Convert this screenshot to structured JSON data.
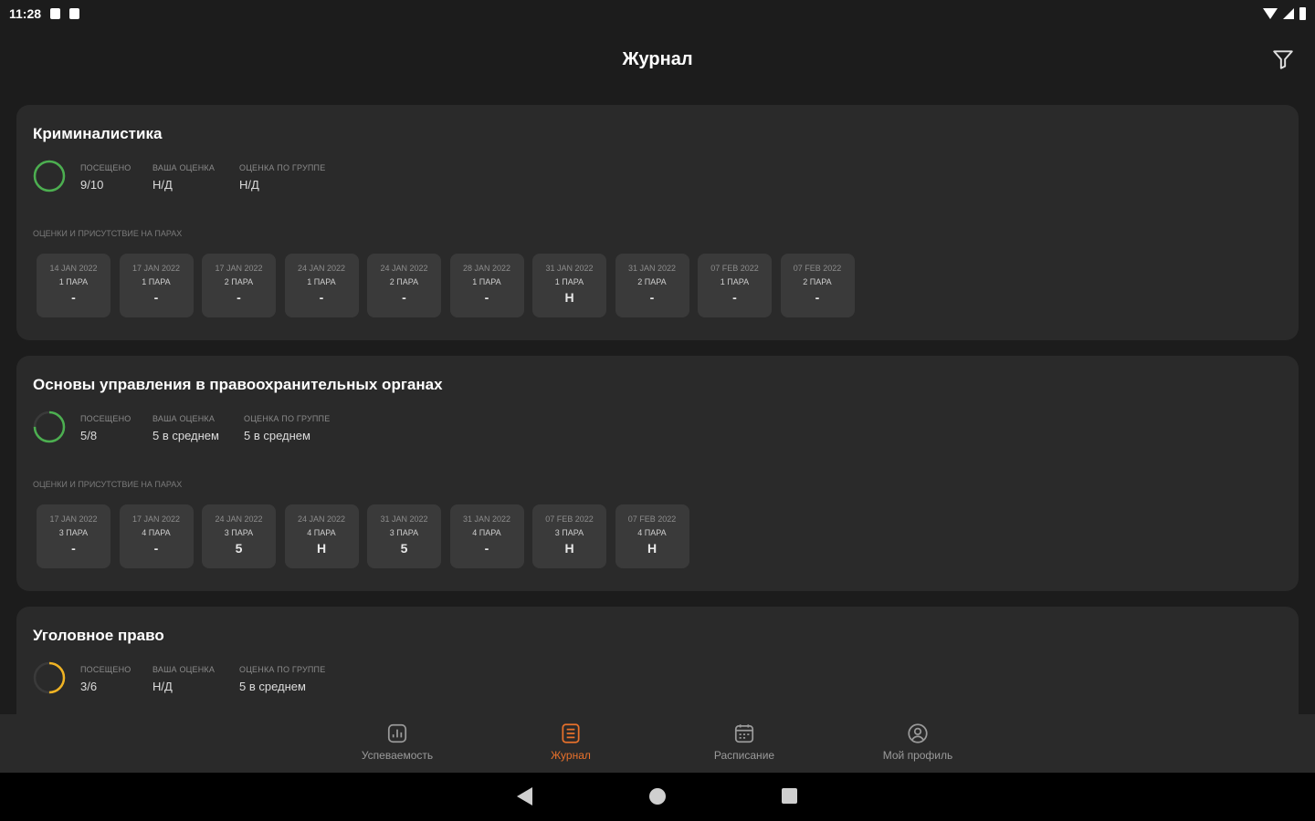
{
  "status_bar": {
    "time": "11:28"
  },
  "app_bar": {
    "title": "Журнал"
  },
  "cards": [
    {
      "title": "Криминалистика",
      "progress": {
        "fraction": 1.0,
        "color": "#4caf50"
      },
      "stats": [
        {
          "label": "посещено",
          "value": "9/10"
        },
        {
          "label": "ваша оценка",
          "value": "Н/Д"
        },
        {
          "label": "оценка по группе",
          "value": "Н/Д"
        }
      ],
      "section_label": "оценки и присутствие на парах",
      "lessons": [
        {
          "date": "14 JAN 2022",
          "pair": "1 ПАРА",
          "mark": "-"
        },
        {
          "date": "17 JAN 2022",
          "pair": "1 ПАРА",
          "mark": "-"
        },
        {
          "date": "17 JAN 2022",
          "pair": "2 ПАРА",
          "mark": "-"
        },
        {
          "date": "24 JAN 2022",
          "pair": "1 ПАРА",
          "mark": "-"
        },
        {
          "date": "24 JAN 2022",
          "pair": "2 ПАРА",
          "mark": "-"
        },
        {
          "date": "28 JAN 2022",
          "pair": "1 ПАРА",
          "mark": "-"
        },
        {
          "date": "31 JAN 2022",
          "pair": "1 ПАРА",
          "mark": "Н"
        },
        {
          "date": "31 JAN 2022",
          "pair": "2 ПАРА",
          "mark": "-"
        },
        {
          "date": "07 FEB 2022",
          "pair": "1 ПАРА",
          "mark": "-"
        },
        {
          "date": "07 FEB 2022",
          "pair": "2 ПАРА",
          "mark": "-"
        }
      ]
    },
    {
      "title": "Основы управления в правоохранительных органах",
      "progress": {
        "fraction": 0.75,
        "color": "#4caf50"
      },
      "stats": [
        {
          "label": "посещено",
          "value": "5/8"
        },
        {
          "label": "ваша оценка",
          "value": "5 в среднем"
        },
        {
          "label": "оценка по группе",
          "value": "5 в среднем"
        }
      ],
      "section_label": "оценки и присутствие на парах",
      "lessons": [
        {
          "date": "17 JAN 2022",
          "pair": "3 ПАРА",
          "mark": "-"
        },
        {
          "date": "17 JAN 2022",
          "pair": "4 ПАРА",
          "mark": "-"
        },
        {
          "date": "24 JAN 2022",
          "pair": "3 ПАРА",
          "mark": "5"
        },
        {
          "date": "24 JAN 2022",
          "pair": "4 ПАРА",
          "mark": "Н"
        },
        {
          "date": "31 JAN 2022",
          "pair": "3 ПАРА",
          "mark": "5"
        },
        {
          "date": "31 JAN 2022",
          "pair": "4 ПАРА",
          "mark": "-"
        },
        {
          "date": "07 FEB 2022",
          "pair": "3 ПАРА",
          "mark": "Н"
        },
        {
          "date": "07 FEB 2022",
          "pair": "4 ПАРА",
          "mark": "Н"
        }
      ]
    },
    {
      "title": "Уголовное право",
      "progress": {
        "fraction": 0.5,
        "color": "#f0b323"
      },
      "stats": [
        {
          "label": "посещено",
          "value": "3/6"
        },
        {
          "label": "ваша оценка",
          "value": "Н/Д"
        },
        {
          "label": "оценка по группе",
          "value": "5 в среднем"
        }
      ],
      "section_label": "",
      "lessons": []
    }
  ],
  "bottom_nav": [
    {
      "label": "Успеваемость",
      "icon": "chart-icon",
      "active": false
    },
    {
      "label": "Журнал",
      "icon": "journal-icon",
      "active": true
    },
    {
      "label": "Расписание",
      "icon": "calendar-icon",
      "active": false
    },
    {
      "label": "Мой профиль",
      "icon": "profile-icon",
      "active": false
    }
  ],
  "colors": {
    "accent": "#e8712b",
    "background": "#1c1c1c",
    "card": "#2a2a2a",
    "tile": "#3a3a3a"
  }
}
